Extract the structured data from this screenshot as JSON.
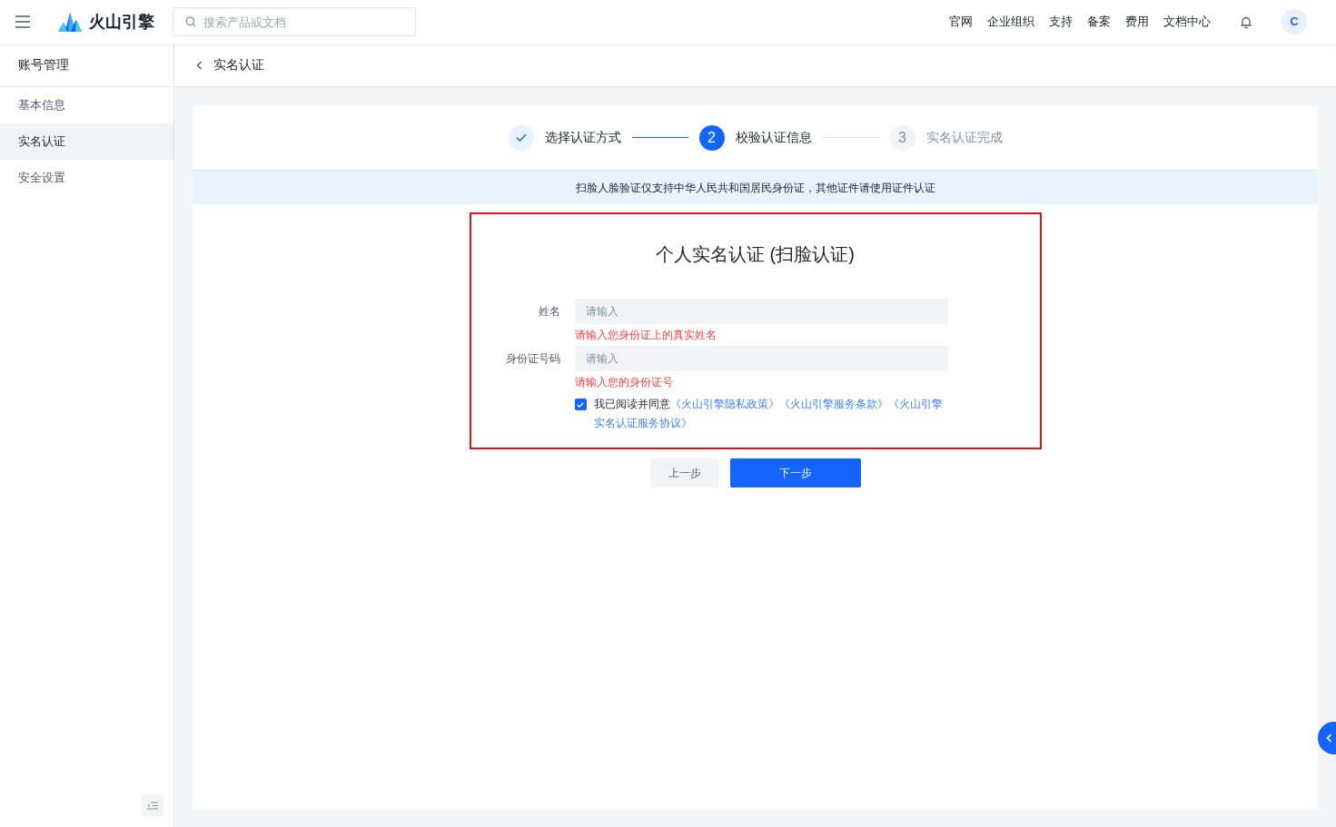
{
  "header": {
    "brand": "火山引擎",
    "search": {
      "placeholder": "搜索产品或文档"
    },
    "nav": [
      "官网",
      "企业组织",
      "支持",
      "备案",
      "费用",
      "文档中心"
    ],
    "avatar": "C"
  },
  "sidebar": {
    "title": "账号管理",
    "items": [
      {
        "label": "基本信息",
        "selected": false
      },
      {
        "label": "实名认证",
        "selected": true
      },
      {
        "label": "安全设置",
        "selected": false
      }
    ]
  },
  "breadcrumb": {
    "title": "实名认证"
  },
  "steps": [
    {
      "label": "选择认证方式",
      "done": true,
      "selected": false
    },
    {
      "label": "校验认证信息",
      "done": false,
      "selected": true,
      "number": "2"
    },
    {
      "label": "实名认证完成",
      "done": false,
      "selected": false,
      "number": "3"
    }
  ],
  "notice": "扫脸人脸验证仅支持中华人民共和国居民身份证，其他证件请使用证件认证",
  "form": {
    "title": "个人实名认证 (扫脸认证)",
    "fields": [
      {
        "label": "姓名",
        "placeholder": "请输入",
        "error": "请输入您身份证上的真实姓名"
      },
      {
        "label": "身份证号码",
        "placeholder": "请输入",
        "error": "请输入您的身份证号"
      }
    ],
    "agreement": {
      "checked": true,
      "text": "我已阅读并同意",
      "links": [
        "《火山引擎隐私政策》",
        "《火山引擎服务条款》",
        "《火山引擎实名认证服务协议》"
      ]
    }
  },
  "buttons": [
    {
      "label": "上一步",
      "kind": "secondary"
    },
    {
      "label": "下一步",
      "kind": "primary"
    }
  ]
}
